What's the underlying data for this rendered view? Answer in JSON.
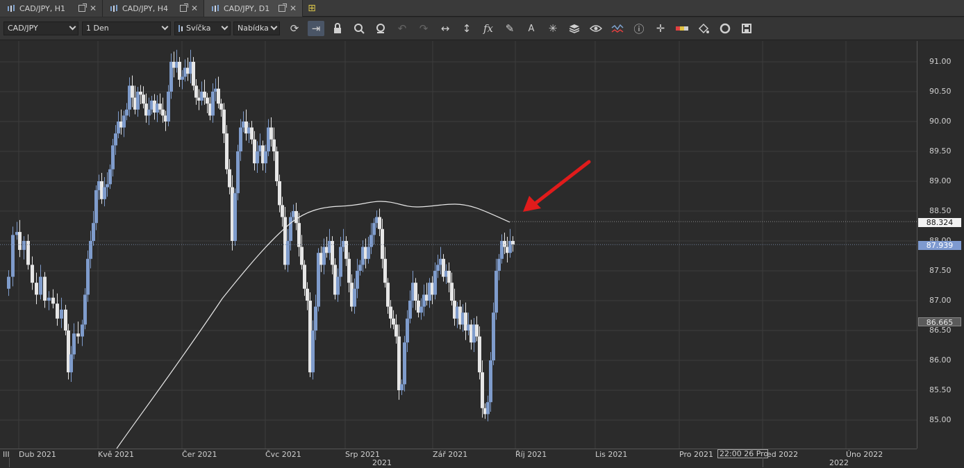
{
  "tabs": [
    {
      "label": "CAD/JPY, H1"
    },
    {
      "label": "CAD/JPY, H4"
    },
    {
      "label": "CAD/JPY, D1"
    }
  ],
  "toolbar": {
    "symbol": "CAD/JPY",
    "timeframe": "1 Den",
    "chart_type": "Svíčka",
    "menu": "Nabídka",
    "icons": [
      "refresh-icon",
      "scroll-right-icon",
      "lock-icon",
      "zoom-in-icon",
      "zoom-out-icon",
      "undo-icon",
      "redo-icon",
      "horizontal-resize-icon",
      "vertical-resize-icon",
      "function-icon",
      "pencil-icon",
      "text-icon",
      "crosshair-star-icon",
      "layers-icon",
      "eye-icon",
      "indicator-icon",
      "info-icon",
      "cursor-cross-icon",
      "color-bar-icon",
      "paint-bucket-icon",
      "circle-icon",
      "save-icon"
    ]
  },
  "price_axis": {
    "labels": [
      "91.00",
      "90.50",
      "90.00",
      "89.50",
      "89.00",
      "88.50",
      "88.00",
      "87.50",
      "87.00",
      "86.50",
      "86.00",
      "85.50",
      "85.00"
    ],
    "tags": [
      {
        "label": "88.324",
        "style": "white"
      },
      {
        "label": "87.939",
        "style": "blue"
      },
      {
        "label": "86.665",
        "style": "gray"
      }
    ]
  },
  "time_axis": {
    "labels": [
      "III",
      "Dub 2021",
      "Kvě 2021",
      "Čer 2021",
      "Čvc 2021",
      "Srp 2021",
      "Zář 2021",
      "Říj 2021",
      "Lis 2021",
      "Pro 2021",
      "Led 2022",
      "Úno 2022"
    ],
    "years": [
      "2021",
      "2022"
    ],
    "crosshair_time": "22:00 26 Pro"
  },
  "colors": {
    "background": "#2b2b2b",
    "bull": "#7f9ccc",
    "bear": "#e6e6e6",
    "grid": "#3c3c3c",
    "ma_line": "#e8e8e8",
    "arrow": "#e01b1b"
  }
}
